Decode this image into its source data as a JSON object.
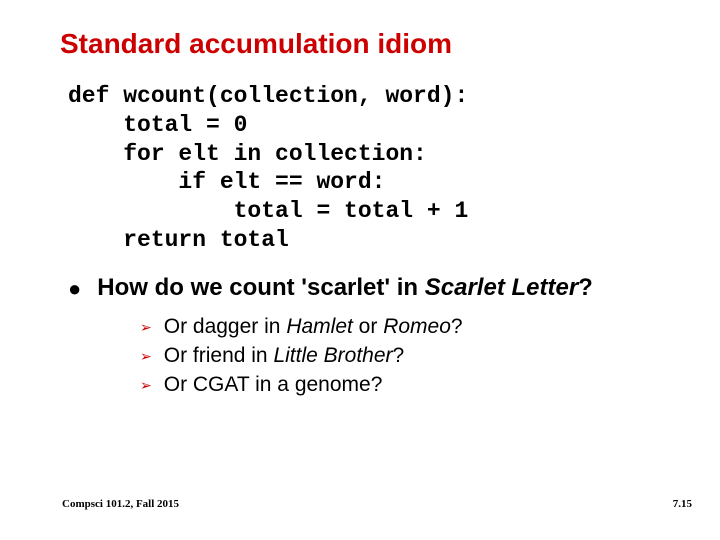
{
  "title": "Standard accumulation idiom",
  "code": {
    "l1": "def wcount(collection, word):",
    "l2": "    total = 0",
    "l3": "    for elt in collection:",
    "l4": "        if elt == word:",
    "l5": "            total = total + 1",
    "l6": "    return total"
  },
  "question": {
    "pre": "How do we count 'scarlet' in ",
    "ital": "Scarlet Letter",
    "post": "?"
  },
  "sub": [
    {
      "pre": "Or dagger in ",
      "ital1": "Hamlet",
      "mid": " or ",
      "ital2": "Romeo",
      "post": "?"
    },
    {
      "pre": "Or friend in ",
      "ital1": "Little Brother",
      "mid": "",
      "ital2": "",
      "post": "?"
    },
    {
      "pre": "Or CGAT in a genome?",
      "ital1": "",
      "mid": "",
      "ital2": "",
      "post": ""
    }
  ],
  "footer": {
    "left": "Compsci 101.2, Fall 2015",
    "right": "7.15"
  }
}
